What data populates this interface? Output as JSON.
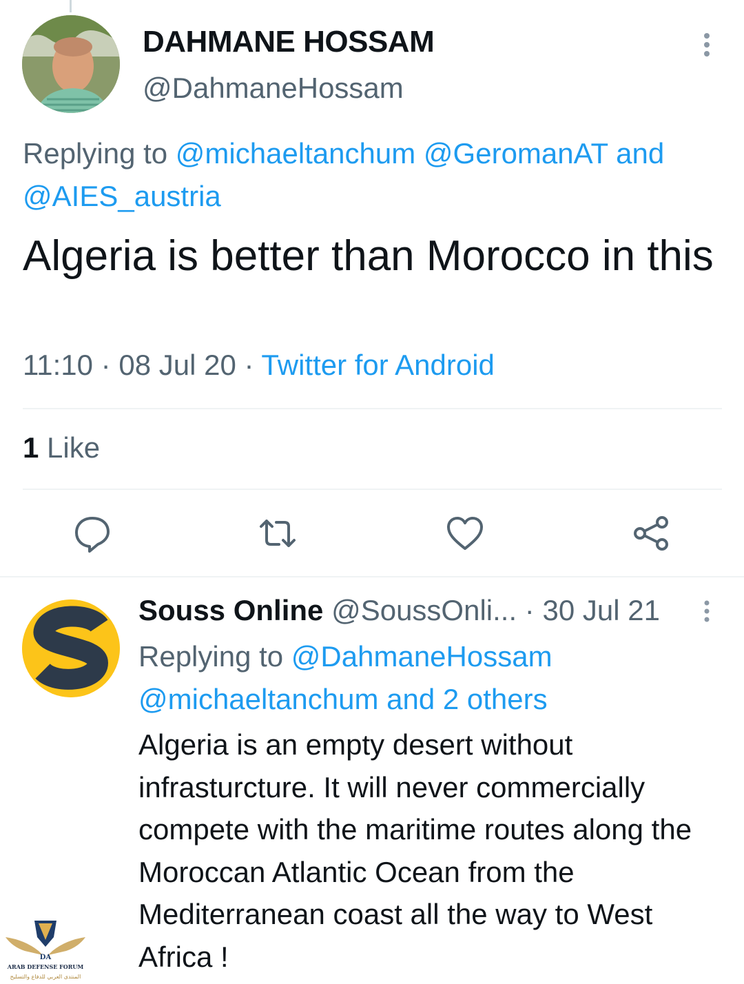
{
  "tweet": {
    "display_name": "DAHMANE HOSSAM",
    "handle": "@DahmaneHossam",
    "replying_prefix": "Replying to",
    "replying_mentions": [
      "@michaeltanchum",
      "@GeromanAT"
    ],
    "replying_and": "and",
    "replying_last": "@AIES_austria",
    "text": "Algeria is better than Morocco in this",
    "time": "11:10",
    "date": "08 Jul 20",
    "separator": "·",
    "source": "Twitter for Android",
    "like_count": "1",
    "like_label": "Like",
    "actions": [
      "reply-icon",
      "retweet-icon",
      "like-icon",
      "share-icon"
    ]
  },
  "reply": {
    "display_name": "Souss Online",
    "handle": "@SoussOnli...",
    "date": "30 Jul 21",
    "separator": "·",
    "avatar_letter": "S",
    "replying_prefix": "Replying to",
    "replying_first": "@DahmaneHossam",
    "replying_second": "@michaeltanchum and 2 others",
    "text": "Algeria is an empty desert without infrasturcture. It will never commercially compete with the maritime routes along the Moroccan Atlantic Ocean from the Mediterranean coast all the way to West Africa !"
  },
  "watermark": {
    "logo_letters": "DA",
    "name": "ARAB DEFENSE FORUM",
    "arabic": "المنتدى العربي للدفاع والتسليح"
  },
  "colors": {
    "link": "#1d9bf0",
    "secondary_text": "#536471",
    "primary_text": "#0f1419",
    "divider": "#eff3f4",
    "souss_yellow": "#fcc419",
    "souss_navy": "#2d3a4a"
  }
}
